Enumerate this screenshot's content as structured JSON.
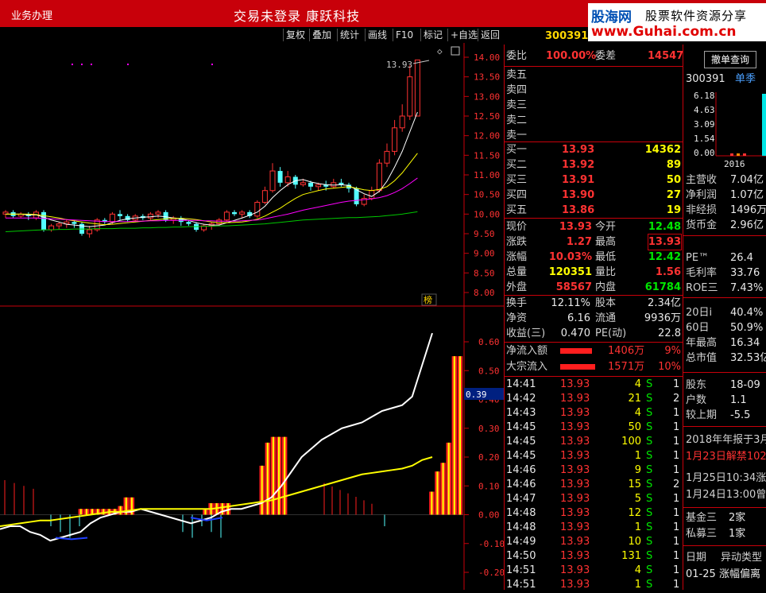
{
  "titlebar": {
    "menu": "业务办理",
    "title": "交易未登录   康跃科技"
  },
  "logo": {
    "brand": "股海网",
    "slogan": "股票软件资源分享",
    "url": "www.Guhai.com.cn"
  },
  "toolbar": [
    "复权",
    "叠加",
    "统计",
    "画线",
    "F10",
    "标记",
    "+自选",
    "返回"
  ],
  "stock": {
    "code": "300391"
  },
  "chart": {
    "price_axis": [
      "14.00",
      "13.50",
      "13.00",
      "12.50",
      "12.00",
      "11.50",
      "11.00",
      "10.50",
      "10.00",
      "9.50",
      "9.00",
      "8.50",
      "8.00"
    ],
    "high_label": "13.93",
    "rank_badge": "榜",
    "ind_axis": [
      "0.60",
      "0.50",
      "0.40",
      "0.30",
      "0.20",
      "0.10",
      "0.00",
      "-0.10",
      "-0.20"
    ],
    "ind_value": "0.39"
  },
  "chart_data": {
    "type": "candlestick",
    "ylim": [
      8.0,
      14.0
    ],
    "candles": [
      [
        10.0,
        10.05,
        9.9,
        10.1
      ],
      [
        10.05,
        9.95,
        9.9,
        10.1
      ],
      [
        9.95,
        10.0,
        9.9,
        10.05
      ],
      [
        10.0,
        9.95,
        9.85,
        10.05
      ],
      [
        9.9,
        10.05,
        9.85,
        10.1
      ],
      [
        10.05,
        9.6,
        9.55,
        10.1
      ],
      [
        9.6,
        9.7,
        9.55,
        9.75
      ],
      [
        9.7,
        9.75,
        9.6,
        9.8
      ],
      [
        9.75,
        9.8,
        9.65,
        9.85
      ],
      [
        9.8,
        9.75,
        9.65,
        9.85
      ],
      [
        9.75,
        9.5,
        9.45,
        9.8
      ],
      [
        9.5,
        9.6,
        9.4,
        9.7
      ],
      [
        9.6,
        9.85,
        9.55,
        9.9
      ],
      [
        9.85,
        9.8,
        9.75,
        9.9
      ],
      [
        9.8,
        10.0,
        9.75,
        10.05
      ],
      [
        10.0,
        9.95,
        9.85,
        10.1
      ],
      [
        9.95,
        9.85,
        9.8,
        10.0
      ],
      [
        9.85,
        9.95,
        9.8,
        10.0
      ],
      [
        9.95,
        9.9,
        9.85,
        10.0
      ],
      [
        9.9,
        10.0,
        9.85,
        10.05
      ],
      [
        10.0,
        10.05,
        9.9,
        10.1
      ],
      [
        10.05,
        9.85,
        9.8,
        10.1
      ],
      [
        9.85,
        9.9,
        9.75,
        9.95
      ],
      [
        9.9,
        9.8,
        9.7,
        9.95
      ],
      [
        9.8,
        9.75,
        9.7,
        9.85
      ],
      [
        9.75,
        9.6,
        9.55,
        9.8
      ],
      [
        9.6,
        9.7,
        9.55,
        9.75
      ],
      [
        9.7,
        9.75,
        9.6,
        9.8
      ],
      [
        9.75,
        9.85,
        9.7,
        9.9
      ],
      [
        9.85,
        10.05,
        9.8,
        10.1
      ],
      [
        10.05,
        10.0,
        9.95,
        10.1
      ],
      [
        10.0,
        10.05,
        9.9,
        10.1
      ],
      [
        10.05,
        9.95,
        9.9,
        10.1
      ],
      [
        9.95,
        10.3,
        9.9,
        10.35
      ],
      [
        10.3,
        10.6,
        10.25,
        10.7
      ],
      [
        10.6,
        11.1,
        10.55,
        11.3
      ],
      [
        11.1,
        10.8,
        10.7,
        11.2
      ],
      [
        10.8,
        10.95,
        10.7,
        11.1
      ],
      [
        10.95,
        10.75,
        10.65,
        11.0
      ],
      [
        10.75,
        10.8,
        10.7,
        10.9
      ],
      [
        10.8,
        10.7,
        10.6,
        10.85
      ],
      [
        10.7,
        10.75,
        10.6,
        10.8
      ],
      [
        10.75,
        10.7,
        10.6,
        10.85
      ],
      [
        10.7,
        10.8,
        10.65,
        10.9
      ],
      [
        10.8,
        10.75,
        10.7,
        10.9
      ],
      [
        10.75,
        10.65,
        10.55,
        10.8
      ],
      [
        10.65,
        10.25,
        10.2,
        10.7
      ],
      [
        10.25,
        10.4,
        10.2,
        10.5
      ],
      [
        10.4,
        10.6,
        10.35,
        10.7
      ],
      [
        10.6,
        11.3,
        10.55,
        11.4
      ],
      [
        11.3,
        11.6,
        11.2,
        11.8
      ],
      [
        11.6,
        12.2,
        11.5,
        12.4
      ],
      [
        12.2,
        12.5,
        12.1,
        12.8
      ],
      [
        12.5,
        13.5,
        12.4,
        13.8
      ],
      [
        12.5,
        13.93,
        12.5,
        13.93
      ]
    ],
    "ma": [
      {
        "name": "MA5",
        "color": "#ffffff",
        "values": [
          10.0,
          10.0,
          10.0,
          9.98,
          9.98,
          9.92,
          9.85,
          9.8,
          9.74,
          9.72,
          9.7,
          9.68,
          9.7,
          9.72,
          9.78,
          9.84,
          9.88,
          9.9,
          9.92,
          9.93,
          9.95,
          9.93,
          9.9,
          9.88,
          9.84,
          9.78,
          9.74,
          9.72,
          9.72,
          9.78,
          9.84,
          9.9,
          9.97,
          10.05,
          10.2,
          10.42,
          10.6,
          10.75,
          10.85,
          10.88,
          10.82,
          10.78,
          10.75,
          10.74,
          10.75,
          10.73,
          10.62,
          10.52,
          10.45,
          10.58,
          10.84,
          11.2,
          11.6,
          12.1,
          12.6
        ]
      },
      {
        "name": "MA10",
        "color": "#ffff00",
        "values": [
          10.0,
          10.0,
          10.0,
          10.0,
          9.99,
          9.96,
          9.93,
          9.9,
          9.86,
          9.83,
          9.8,
          9.77,
          9.75,
          9.73,
          9.74,
          9.76,
          9.78,
          9.8,
          9.82,
          9.84,
          9.86,
          9.88,
          9.89,
          9.89,
          9.88,
          9.86,
          9.83,
          9.8,
          9.78,
          9.78,
          9.79,
          9.8,
          9.83,
          9.87,
          9.95,
          10.05,
          10.15,
          10.28,
          10.4,
          10.5,
          10.55,
          10.6,
          10.64,
          10.66,
          10.68,
          10.7,
          10.66,
          10.62,
          10.6,
          10.63,
          10.7,
          10.85,
          11.05,
          11.3,
          11.55
        ]
      },
      {
        "name": "MA20",
        "color": "#ff00ff",
        "values": [
          9.9,
          9.9,
          9.9,
          9.9,
          9.9,
          9.89,
          9.88,
          9.87,
          9.86,
          9.85,
          9.84,
          9.83,
          9.82,
          9.81,
          9.81,
          9.81,
          9.81,
          9.82,
          9.82,
          9.83,
          9.83,
          9.84,
          9.84,
          9.84,
          9.84,
          9.84,
          9.83,
          9.83,
          9.82,
          9.82,
          9.82,
          9.83,
          9.84,
          9.85,
          9.88,
          9.92,
          9.96,
          10.0,
          10.05,
          10.1,
          10.14,
          10.18,
          10.22,
          10.26,
          10.3,
          10.33,
          10.35,
          10.37,
          10.39,
          10.42,
          10.47,
          10.55,
          10.65,
          10.78,
          10.92
        ]
      },
      {
        "name": "MA60",
        "color": "#00c800",
        "values": [
          9.55,
          9.56,
          9.57,
          9.58,
          9.59,
          9.6,
          9.6,
          9.61,
          9.61,
          9.62,
          9.62,
          9.62,
          9.63,
          9.63,
          9.63,
          9.64,
          9.64,
          9.64,
          9.65,
          9.65,
          9.66,
          9.66,
          9.67,
          9.67,
          9.68,
          9.68,
          9.69,
          9.69,
          9.7,
          9.7,
          9.71,
          9.72,
          9.73,
          9.74,
          9.75,
          9.77,
          9.79,
          9.81,
          9.83,
          9.85,
          9.86,
          9.87,
          9.88,
          9.89,
          9.9,
          9.91,
          9.91,
          9.92,
          9.93,
          9.94,
          9.96,
          9.98,
          10.0,
          10.03,
          10.06
        ]
      }
    ],
    "indicator": {
      "ylim": [
        -0.25,
        0.65
      ],
      "bars": [
        0.0,
        0.0,
        0.0,
        0.0,
        0.0,
        0.0,
        0.0,
        0.0,
        0.0,
        0.0,
        0.0,
        0.0,
        0.0,
        0.02,
        0.02,
        0.02,
        0.02,
        0.02,
        0.02,
        0.02,
        0.03,
        0.06,
        0.06,
        0.0,
        0.0,
        0.0,
        0.0,
        0.0,
        0.0,
        0.0,
        0.0,
        0.0,
        0.0,
        0.0,
        0.0,
        0.02,
        0.04,
        0.04,
        0.04,
        0.04,
        0.0,
        0.0,
        0.0,
        0.0,
        0.0,
        0.17,
        0.25,
        0.27,
        0.27,
        0.27,
        0.0,
        0.0,
        0.0,
        0.0,
        0.0,
        0.0,
        0.0,
        0.0,
        0.0,
        0.0,
        0.0,
        0.0,
        0.0,
        0.0,
        0.0,
        0.0,
        0.0,
        0.0,
        0.0,
        0.0,
        0.0,
        0.0,
        0.0,
        0.0,
        0.0,
        0.08,
        0.15,
        0.18,
        0.25,
        0.55,
        0.55
      ],
      "white": [
        -0.05,
        -0.04,
        -0.04,
        -0.06,
        -0.07,
        -0.09,
        -0.08,
        -0.07,
        -0.06,
        -0.03,
        -0.01,
        0.0,
        0.01,
        0.01,
        0.02,
        0.01,
        0.0,
        -0.01,
        -0.02,
        -0.03,
        -0.02,
        -0.01,
        0.01,
        0.02,
        0.02,
        0.03,
        0.04,
        0.06,
        0.1,
        0.15,
        0.2,
        0.23,
        0.26,
        0.28,
        0.3,
        0.31,
        0.32,
        0.34,
        0.36,
        0.37,
        0.38,
        0.41,
        0.52,
        0.63
      ],
      "yellow": [
        -0.04,
        -0.035,
        -0.03,
        -0.025,
        -0.02,
        -0.02,
        -0.015,
        -0.01,
        -0.005,
        0.0,
        0.005,
        0.01,
        0.01,
        0.015,
        0.02,
        0.02,
        0.02,
        0.02,
        0.02,
        0.02,
        0.02,
        0.02,
        0.025,
        0.03,
        0.035,
        0.04,
        0.045,
        0.05,
        0.06,
        0.07,
        0.08,
        0.09,
        0.1,
        0.11,
        0.12,
        0.13,
        0.14,
        0.145,
        0.15,
        0.155,
        0.16,
        0.17,
        0.19,
        0.2
      ]
    }
  },
  "quote": {
    "weibi": {
      "label": "委比",
      "value": "100.00%",
      "label2": "委差",
      "value2": "14547"
    },
    "sells": [
      {
        "label": "卖五"
      },
      {
        "label": "卖四"
      },
      {
        "label": "卖三"
      },
      {
        "label": "卖二"
      },
      {
        "label": "卖一"
      }
    ],
    "buys": [
      {
        "label": "买一",
        "price": "13.93",
        "vol": "14362"
      },
      {
        "label": "买二",
        "price": "13.92",
        "vol": "89"
      },
      {
        "label": "买三",
        "price": "13.91",
        "vol": "50"
      },
      {
        "label": "买四",
        "price": "13.90",
        "vol": "27"
      },
      {
        "label": "买五",
        "price": "13.86",
        "vol": "19"
      }
    ],
    "stats": [
      {
        "l1": "现价",
        "v1": "13.93",
        "c1": "red",
        "l2": "今开",
        "v2": "12.48",
        "c2": "grn"
      },
      {
        "l1": "涨跌",
        "v1": "1.27",
        "c1": "red",
        "l2": "最高",
        "v2": "13.93",
        "c2": "red"
      },
      {
        "l1": "涨幅",
        "v1": "10.03%",
        "c1": "red",
        "l2": "最低",
        "v2": "12.42",
        "c2": "grn"
      },
      {
        "l1": "总量",
        "v1": "120351",
        "c1": "ylw",
        "l2": "量比",
        "v2": "1.56",
        "c2": "red"
      },
      {
        "l1": "外盘",
        "v1": "58567",
        "c1": "red",
        "l2": "内盘",
        "v2": "61784",
        "c2": "grn"
      }
    ],
    "fund": [
      {
        "l1": "换手",
        "v1": "12.11%",
        "l2": "股本",
        "v2": "2.34亿"
      },
      {
        "l1": "净资",
        "v1": "6.16",
        "l2": "流通",
        "v2": "9936万"
      },
      {
        "l1": "收益(三)",
        "v1": "0.470",
        "l2": "PE(动)",
        "v2": "22.8"
      }
    ],
    "flow": [
      {
        "label": "净流入额",
        "value": "1406万",
        "pct": "9%"
      },
      {
        "label": "大宗流入",
        "value": "1571万",
        "pct": "10%"
      }
    ],
    "ticks": [
      {
        "t": "14:41",
        "p": "13.93",
        "v": "4",
        "s": "S",
        "n": "1"
      },
      {
        "t": "14:42",
        "p": "13.93",
        "v": "21",
        "s": "S",
        "n": "2"
      },
      {
        "t": "14:43",
        "p": "13.93",
        "v": "4",
        "s": "S",
        "n": "1"
      },
      {
        "t": "14:45",
        "p": "13.93",
        "v": "50",
        "s": "S",
        "n": "1"
      },
      {
        "t": "14:45",
        "p": "13.93",
        "v": "100",
        "s": "S",
        "n": "1"
      },
      {
        "t": "14:45",
        "p": "13.93",
        "v": "1",
        "s": "S",
        "n": "1"
      },
      {
        "t": "14:46",
        "p": "13.93",
        "v": "9",
        "s": "S",
        "n": "1"
      },
      {
        "t": "14:46",
        "p": "13.93",
        "v": "15",
        "s": "S",
        "n": "2"
      },
      {
        "t": "14:47",
        "p": "13.93",
        "v": "5",
        "s": "S",
        "n": "1"
      },
      {
        "t": "14:48",
        "p": "13.93",
        "v": "12",
        "s": "S",
        "n": "1"
      },
      {
        "t": "14:48",
        "p": "13.93",
        "v": "1",
        "s": "S",
        "n": "1"
      },
      {
        "t": "14:49",
        "p": "13.93",
        "v": "10",
        "s": "S",
        "n": "1"
      },
      {
        "t": "14:50",
        "p": "13.93",
        "v": "131",
        "s": "S",
        "n": "1"
      },
      {
        "t": "14:51",
        "p": "13.93",
        "v": "4",
        "s": "S",
        "n": "1"
      },
      {
        "t": "14:51",
        "p": "13.93",
        "v": "1",
        "s": "S",
        "n": "1"
      }
    ]
  },
  "side": {
    "cancel_btn": "撤单查询",
    "code": "300391",
    "season": "单季",
    "mini_axis": [
      "6.18",
      "4.63",
      "3.09",
      "1.54",
      "0.00"
    ],
    "mini_year": "2016",
    "rows": [
      {
        "l": "主营收",
        "v": "7.04亿"
      },
      {
        "l": "净利润",
        "v": "1.07亿"
      },
      {
        "l": "非经损",
        "v": "1496万"
      },
      {
        "l": "货币金",
        "v": "2.96亿"
      }
    ],
    "rows2": [
      {
        "l": "PE™",
        "v": "26.4"
      },
      {
        "l": "毛利率",
        "v": "33.76"
      },
      {
        "l": "ROE三",
        "v": "7.43%"
      }
    ],
    "rows3": [
      {
        "l": "20日i",
        "v": "40.4%"
      },
      {
        "l": "60日",
        "v": "50.9%"
      },
      {
        "l": "年最高",
        "v": "16.34"
      },
      {
        "l": "总市值",
        "v": "32.53亿"
      }
    ],
    "rows4": [
      {
        "l": "股东",
        "v": "18-09"
      },
      {
        "l": "户数",
        "v": "1.1"
      },
      {
        "l": "较上期",
        "v": "-5.5"
      }
    ],
    "news": [
      "2018年年报于3月",
      "1月23日解禁102",
      "1月25日10:34涨",
      "1月24日13:00曾"
    ],
    "inst": [
      {
        "l": "基金三",
        "v": "2家"
      },
      {
        "l": "私募三",
        "v": "1家"
      }
    ],
    "table_head": {
      "c1": "日期",
      "c2": "异动类型"
    },
    "table_row": {
      "c1": "01-25",
      "c2": "涨幅偏离"
    }
  }
}
